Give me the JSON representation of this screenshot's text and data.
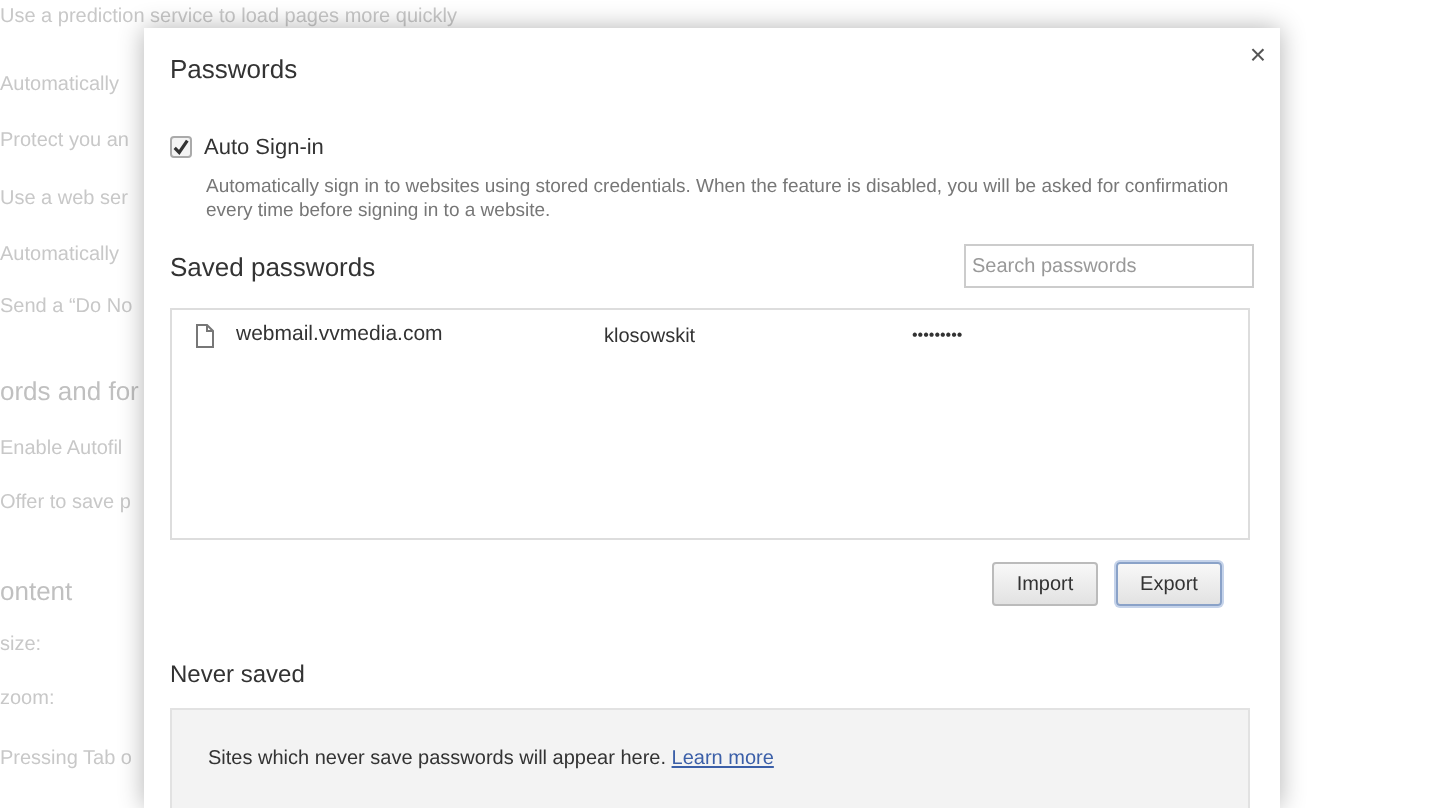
{
  "background": {
    "top_line": "Use a prediction service to load pages more quickly",
    "lines": [
      {
        "kind": "item",
        "text": "Automatically"
      },
      {
        "kind": "item",
        "text": "Protect you an"
      },
      {
        "kind": "item",
        "text": "Use a web ser"
      },
      {
        "kind": "item",
        "text": "Automatically"
      },
      {
        "kind": "item",
        "text": "Send a “Do No"
      },
      {
        "kind": "heading",
        "text": "ords and for"
      },
      {
        "kind": "item",
        "text": "Enable Autofil"
      },
      {
        "kind": "item",
        "text": "Offer to save p"
      },
      {
        "kind": "heading",
        "text": "ontent"
      },
      {
        "kind": "item",
        "text": "size:"
      },
      {
        "kind": "item",
        "text": "zoom:"
      },
      {
        "kind": "item",
        "text": "Pressing Tab o"
      }
    ]
  },
  "dialog": {
    "title": "Passwords",
    "close": "×",
    "auto_sign_in": {
      "label": "Auto Sign-in",
      "checked": true,
      "description": "Automatically sign in to websites using stored credentials. When the feature is disabled, you will be asked for confirmation every time before signing in to a website."
    },
    "saved": {
      "heading": "Saved passwords",
      "search": {
        "placeholder": "Search passwords"
      },
      "rows": [
        {
          "site": "webmail.vvmedia.com",
          "username": "klosowskit",
          "password": "•••••••••"
        }
      ],
      "buttons": [
        {
          "label": "Import",
          "selected": false
        },
        {
          "label": "Export",
          "selected": true
        }
      ]
    },
    "never_saved": {
      "heading": "Never saved",
      "message": "Sites which never save passwords will appear here.",
      "link": "Learn more"
    }
  }
}
